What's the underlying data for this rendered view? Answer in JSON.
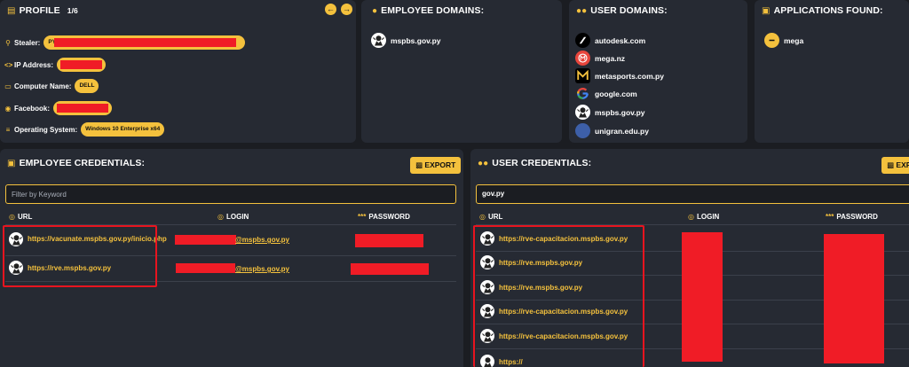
{
  "profile": {
    "title": "PROFILE",
    "count": "1/6",
    "fields": [
      {
        "label": "Stealer:",
        "value": "PY",
        "icon": "key-icon"
      },
      {
        "label": "IP Address:",
        "value": "",
        "icon": "code-icon"
      },
      {
        "label": "Computer Name:",
        "value": "DELL",
        "icon": "monitor-icon"
      },
      {
        "label": "Facebook:",
        "value": "",
        "icon": "facebook-icon"
      },
      {
        "label": "Operating System:",
        "value": "Windows 10 Enterprise x64",
        "icon": "server-icon"
      }
    ]
  },
  "employee_domains": {
    "title": "EMPLOYEE DOMAINS:",
    "items": [
      "mspbs.gov.py"
    ]
  },
  "user_domains": {
    "title": "USER DOMAINS:",
    "items": [
      "autodesk.com",
      "mega.nz",
      "metasports.com.py",
      "google.com",
      "mspbs.gov.py",
      "unigran.edu.py"
    ]
  },
  "applications": {
    "title": "APPLICATIONS FOUND:",
    "items": [
      "mega"
    ]
  },
  "employee_credentials": {
    "title": "EMPLOYEE CREDENTIALS:",
    "export_label": "EXPORT",
    "filter_placeholder": "Filter by Keyword",
    "columns": {
      "url": "URL",
      "login": "LOGIN",
      "password": "PASSWORD"
    },
    "rows": [
      {
        "url": "https://vacunate.mspbs.gov.py/inicio.php",
        "login": "@mspbs.gov.py"
      },
      {
        "url": "https://rve.mspbs.gov.py",
        "login": "@mspbs.gov.py"
      }
    ]
  },
  "user_credentials": {
    "title": "USER CREDENTIALS:",
    "export_label": "EXPORT",
    "filter_value": "gov.py",
    "columns": {
      "url": "URL",
      "login": "LOGIN",
      "password": "PASSWORD"
    },
    "rows": [
      {
        "url": "https://rve-capacitacion.mspbs.gov.py"
      },
      {
        "url": "https://rve.mspbs.gov.py"
      },
      {
        "url": "https://rve.mspbs.gov.py"
      },
      {
        "url": "https://rve-capacitacion.mspbs.gov.py"
      },
      {
        "url": "https://rve-capacitacion.mspbs.gov.py"
      },
      {
        "url": "https://"
      }
    ]
  },
  "colors": {
    "accent": "#f4c13d",
    "redaction": "#f01c26",
    "panel": "#262a33",
    "background": "#1b1d22"
  }
}
